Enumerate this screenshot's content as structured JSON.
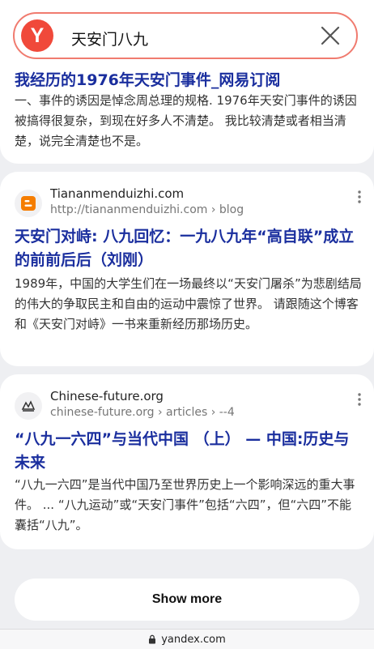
{
  "search": {
    "query": "天安门八九",
    "logo_letter": "Y"
  },
  "results": [
    {
      "title": "我经历的1976年天安门事件_网易订阅",
      "snippet": "一、事件的诱因是悼念周总理的规格. 1976年天安门事件的诱因被搞得很复杂，到现在好多人不清楚。 我比较清楚或者相当清楚，说完全清楚也不是。"
    },
    {
      "site": "Tiananmenduizhi.com",
      "url": "http://tiananmenduizhi.com › blog",
      "title": "天安门对峙: 八九回忆：一九八九年“高自联”成立的前前后后（刘刚）",
      "snippet": "1989年，中国的大学生们在一场最终以“天安门屠杀”为悲剧结局的伟大的争取民主和自由的运动中震惊了世界。 请跟随这个博客和《天安门对峙》一书来重新经历那场历史。"
    },
    {
      "site": "Chinese-future.org",
      "url": "chinese-future.org › articles › --4",
      "title": "“八九一六四”与当代中国 （上） — 中国:历史与未来",
      "snippet": "“八九一六四”是当代中国乃至世界历史上一个影响深远的重大事件。 ... “八九运动”或“天安门事件”包括“六四”，但“六四”不能囊括“八九”。"
    }
  ],
  "show_more": "Show more",
  "footer": {
    "domain": "yandex.com"
  }
}
